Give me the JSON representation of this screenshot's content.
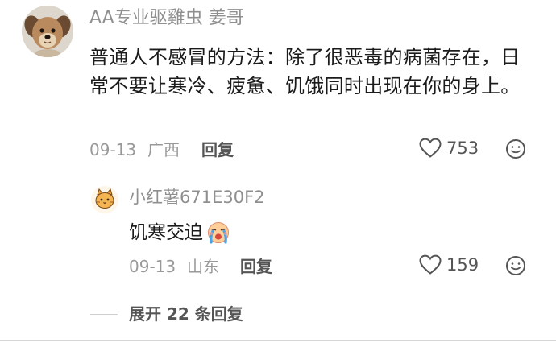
{
  "comment": {
    "username": "AA专业驱雞虫 姜哥",
    "text": "普通人不感冒的方法：除了很恶毒的病菌存在，日常不要让寒冷、疲惫、饥饿同时出现在你的身上。",
    "date": "09-13",
    "location": "广西",
    "reply_label": "回复",
    "likes": "753"
  },
  "reply": {
    "username": "小红薯671E30F2",
    "text": "饥寒交迫",
    "date": "09-13",
    "location": "山东",
    "reply_label": "回复",
    "likes": "159"
  },
  "expand": {
    "label": "展开 22 条回复"
  },
  "icons": {
    "like": "heart-outline-icon",
    "emoji": "smiley-face-icon",
    "reply_emoji": "crying-face-emoji"
  },
  "colors": {
    "text": "#1b1b1b",
    "secondary": "#999999",
    "accent_text": "#555555"
  }
}
